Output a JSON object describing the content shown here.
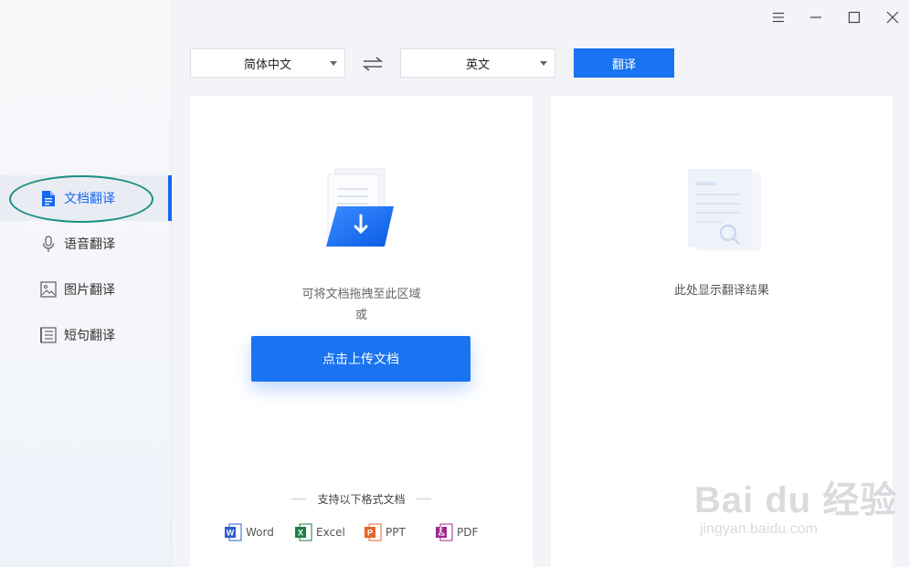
{
  "sidebar": {
    "items": [
      {
        "label": "文档翻译",
        "icon": "document-icon",
        "active": true
      },
      {
        "label": "语音翻译",
        "icon": "microphone-icon",
        "active": false
      },
      {
        "label": "图片翻译",
        "icon": "image-icon",
        "active": false
      },
      {
        "label": "短句翻译",
        "icon": "text-lines-icon",
        "active": false
      }
    ]
  },
  "toolbar": {
    "source_lang": "简体中文",
    "target_lang": "英文",
    "translate_label": "翻译"
  },
  "upload": {
    "drop_hint": "可将文档拖拽至此区域",
    "or_text": "或",
    "button_label": "点击上传文档",
    "formats_title": "支持以下格式文档",
    "formats": [
      {
        "label": "Word",
        "icon": "word-icon",
        "color": "#2b5cce"
      },
      {
        "label": "Excel",
        "icon": "excel-icon",
        "color": "#1e7e45"
      },
      {
        "label": "PPT",
        "icon": "ppt-icon",
        "color": "#e4662c"
      },
      {
        "label": "PDF",
        "icon": "pdf-icon",
        "color": "#9c2a8e"
      }
    ]
  },
  "result": {
    "placeholder": "此处显示翻译结果"
  },
  "watermark": {
    "logo": "Bai du 经验",
    "url": "jingyan.baidu.com"
  },
  "colors": {
    "accent": "#1a73f0",
    "sidebar_active": "#1768ee",
    "highlight_ring": "#1b8f86"
  }
}
